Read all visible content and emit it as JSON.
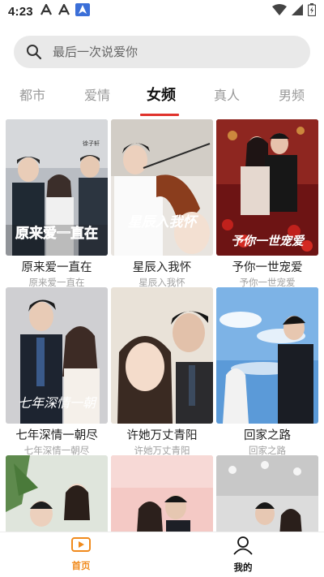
{
  "status_bar": {
    "time": "4:23",
    "left_icons": [
      "app-icon-a",
      "app-icon-a",
      "navigation-icon"
    ],
    "right_icons": [
      "wifi-icon",
      "signal-icon",
      "battery-icon"
    ]
  },
  "search": {
    "placeholder": "最后一次说爱你",
    "icon": "search-icon"
  },
  "tabs": [
    {
      "label": "都市",
      "active": false
    },
    {
      "label": "爱情",
      "active": false
    },
    {
      "label": "女频",
      "active": true
    },
    {
      "label": "真人",
      "active": false
    },
    {
      "label": "男频",
      "active": false
    }
  ],
  "accent_color": "#e0332c",
  "grid": [
    {
      "title": "原来爱一直在",
      "subtitle": "原来爱一直在",
      "poster_text": "原来爱一直在"
    },
    {
      "title": "星辰入我怀",
      "subtitle": "星辰入我怀",
      "poster_text": "星辰入我怀"
    },
    {
      "title": "予你一世宠爱",
      "subtitle": "予你一世宠爱",
      "poster_text": "予你一世宠爱"
    },
    {
      "title": "七年深情一朝尽",
      "subtitle": "七年深情一朝尽",
      "poster_text": "七年深情一朝"
    },
    {
      "title": "许她万丈青阳",
      "subtitle": "许她万丈青阳",
      "poster_text": ""
    },
    {
      "title": "回家之路",
      "subtitle": "回家之路",
      "poster_text": ""
    },
    {
      "title": "",
      "subtitle": "",
      "poster_text": ""
    },
    {
      "title": "",
      "subtitle": "",
      "poster_text": ""
    },
    {
      "title": "",
      "subtitle": "",
      "poster_text": ""
    }
  ],
  "bottom_nav": {
    "home_label": "首页",
    "mine_label": "我的",
    "home_color": "#f08a1c"
  }
}
